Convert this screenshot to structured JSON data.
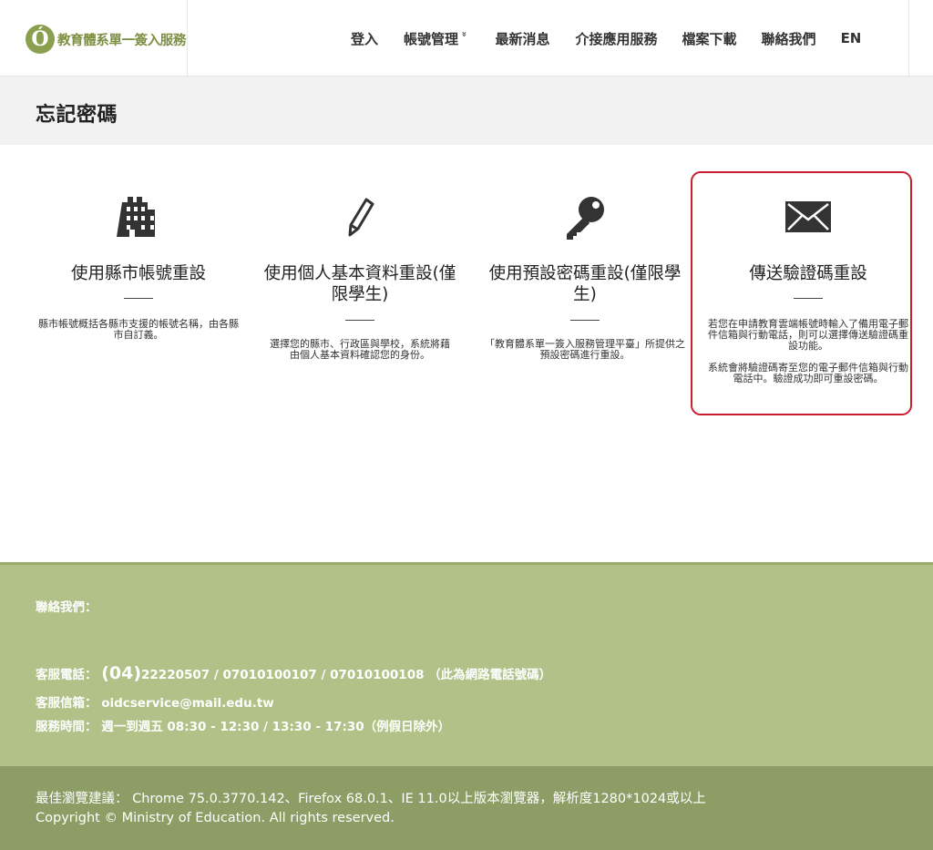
{
  "header": {
    "logo_mark": "Ó",
    "logo_text": "教育體系單一簽入服務",
    "nav": [
      {
        "label": "登入",
        "icon": ""
      },
      {
        "label": "帳號管理",
        "icon": "chevron-double-down-icon"
      },
      {
        "label": "最新消息",
        "icon": ""
      },
      {
        "label": "介接應用服務",
        "icon": ""
      },
      {
        "label": "檔案下載",
        "icon": ""
      },
      {
        "label": "聯絡我們",
        "icon": ""
      },
      {
        "label": "EN",
        "icon": ""
      }
    ],
    "dropdown_caret": "»"
  },
  "page": {
    "title": "忘記密碼"
  },
  "cards": [
    {
      "icon": "building-icon",
      "title": "使用縣市帳號重設",
      "description": [
        "縣市帳號概括各縣市支援的帳號名稱，由各縣市自訂義。"
      ]
    },
    {
      "icon": "pencil-icon",
      "title": "使用個人基本資料重設(僅限學生)",
      "description": [
        "選擇您的縣市、行政區與學校，系統將藉由個人基本資料確認您的身份。"
      ]
    },
    {
      "icon": "key-icon",
      "title": "使用預設密碼重設(僅限學生)",
      "description": [
        "「教育體系單一簽入服務管理平臺」所提供之預設密碼進行重設。"
      ]
    },
    {
      "icon": "envelope-icon",
      "title": "傳送驗證碼重設",
      "description": [
        "若您在申請教育雲端帳號時輸入了備用電子郵件信箱與行動電話，則可以選擇傳送驗證碼重設功能。",
        "系統會將驗證碼寄至您的電子郵件信箱與行動電話中。驗證成功即可重設密碼。"
      ],
      "highlighted": true
    }
  ],
  "footer": {
    "contact_heading": "聯絡我們：",
    "phone_label": "客服電話：",
    "phone_area": "(04)",
    "phone_numbers": "22220507 / 07010100107 / 07010100108 （此為網路電話號碼）",
    "email_label": "客服信箱：",
    "email": "oidcservice@mail.edu.tw",
    "hours_label": "服務時間：",
    "hours": "週一到週五 08:30 - 12:30 / 13:30 - 17:30（例假日除外）",
    "browser_note": "最佳瀏覽建議： Chrome 75.0.3770.142、Firefox 68.0.1、IE 11.0以上版本瀏覽器，解析度1280*1024或以上",
    "copyright": "Copyright © Ministry of Education. All rights reserved."
  },
  "colors": {
    "brand_green": "#8aa04e",
    "footer_contact_bg": "#b1c187",
    "footer_bottom_bg": "#8c9e66",
    "highlight_border": "#c8202f",
    "title_band_bg": "#f2f2f2"
  }
}
